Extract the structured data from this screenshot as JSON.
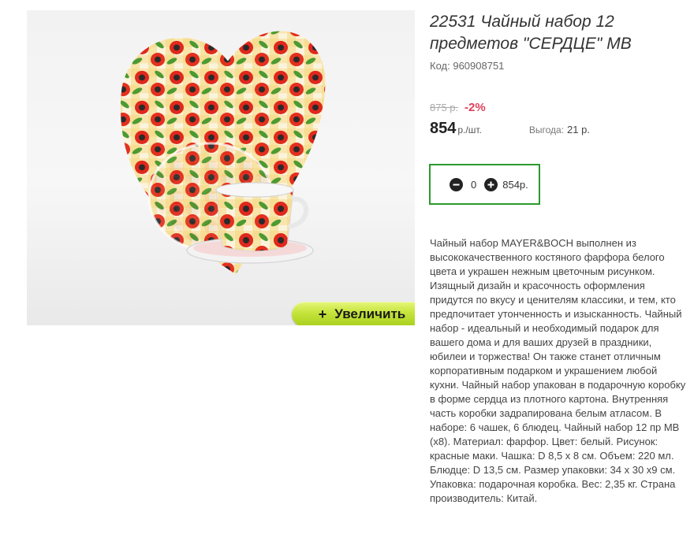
{
  "product": {
    "title": "22531 Чайный набор 12 предметов \"СЕРДЦЕ\" МВ",
    "code_label": "Код:",
    "code_value": "960908751",
    "old_price": "875 р.",
    "discount": "-2%",
    "price": "854",
    "price_unit": "р./шт.",
    "saving_label": "Выгода:",
    "saving_value": "21 р."
  },
  "image": {
    "zoom_plus": "+",
    "zoom_label": "Увеличить"
  },
  "quantity": {
    "value": "0",
    "sum": "854р.",
    "minus_icon": "minus-circle-icon",
    "plus_icon": "plus-circle-icon"
  },
  "description": "Чайный набор MAYER&BOCH выполнен из высококачественного костяного фарфора белого цвета и украшен нежным цветочным рисунком. Изящный дизайн и красочность оформления придутся по вкусу и ценителям классики, и тем, кто предпочитает утонченность и изысканность. Чайный набор - идеальный и необходимый подарок для вашего дома и для ваших друзей в праздники, юбилеи и торжества! Он также станет отличным корпоративным подарком и украшением любой кухни. Чайный набор упакован в подарочную коробку в форме сердца из плотного картона. Внутренняя часть коробки задрапирована белым атласом. В наборе: 6 чашек, 6 блюдец. Чайный набор 12 пр МВ (х8). Материал: фарфор. Цвет: белый. Рисунок: красные маки. Чашка: D 8,5 х 8 см. Объем: 220 мл. Блюдце: D 13,5 см. Размер упаковки: 34 х 30 х9 см. Упаковка: подарочная коробка. Вес: 2,35 кг. Страна производитель: Китай.",
  "colors": {
    "accent_green": "#2c9a2c",
    "discount_red": "#e0405a",
    "button_lime": "#c4e33a"
  }
}
